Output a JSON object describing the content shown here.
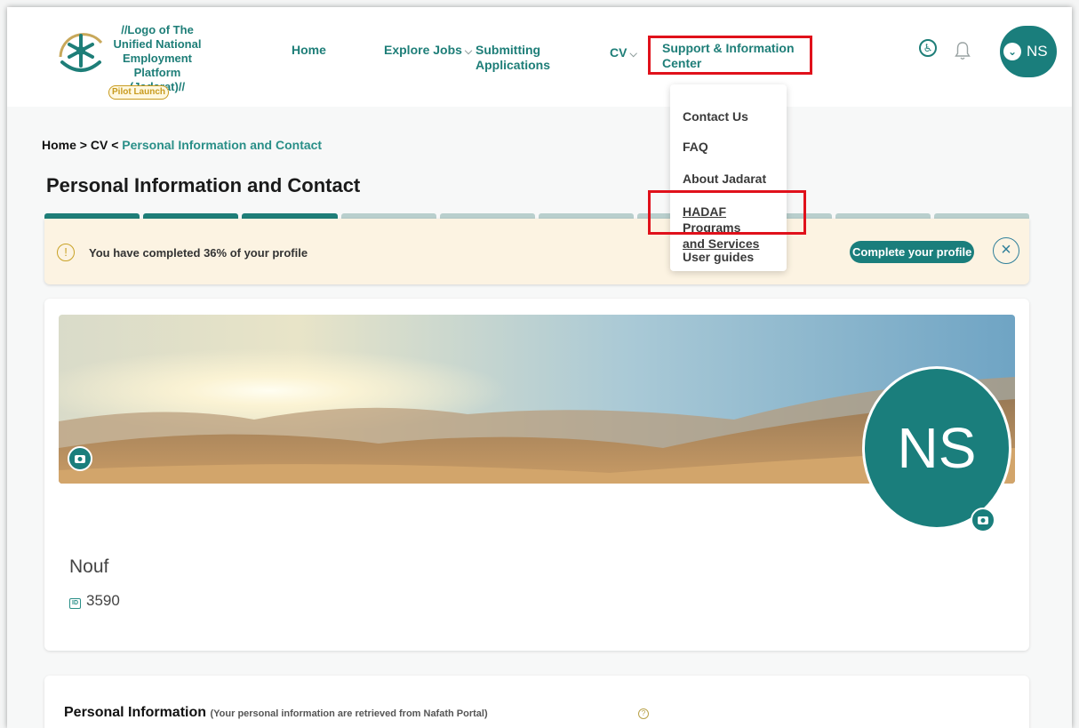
{
  "header": {
    "logo_lines": [
      "//Logo of The",
      "Unified National",
      "Employment",
      "Platform",
      "(Jadarat)//"
    ],
    "pilot_badge": "Pilot Launch",
    "nav": {
      "home": "Home",
      "explore_jobs": "Explore Jobs",
      "submitting_line1": "Submitting",
      "submitting_line2": "Applications",
      "cv": "CV",
      "support_line1": "Support & Information",
      "support_line2": "Center"
    },
    "user_initials": "NS"
  },
  "dropdown": {
    "items": [
      "Contact Us",
      "FAQ",
      "About Jadarat",
      "HADAF Programs",
      "and Services",
      "User guides"
    ]
  },
  "breadcrumb": {
    "home": "Home",
    "sep1": ">",
    "cv": "CV",
    "sep2": "<",
    "current": "Personal Information and Contact"
  },
  "page_title": "Personal Information and Contact",
  "progress": {
    "percent": 36,
    "segments_total": 10,
    "segments_done": 3
  },
  "banner": {
    "message": "You have completed 36% of your profile",
    "button": "Complete your profile"
  },
  "profile": {
    "initials": "NS",
    "name": "Nouf",
    "id_value": "3590"
  },
  "personal_info": {
    "title": "Personal Information",
    "note": "(Your personal information are retrieved from Nafath Portal)"
  },
  "colors": {
    "brand_teal": "#1a7e7c",
    "highlight_red": "#e0111b",
    "banner_bg": "#fcf3e2"
  }
}
